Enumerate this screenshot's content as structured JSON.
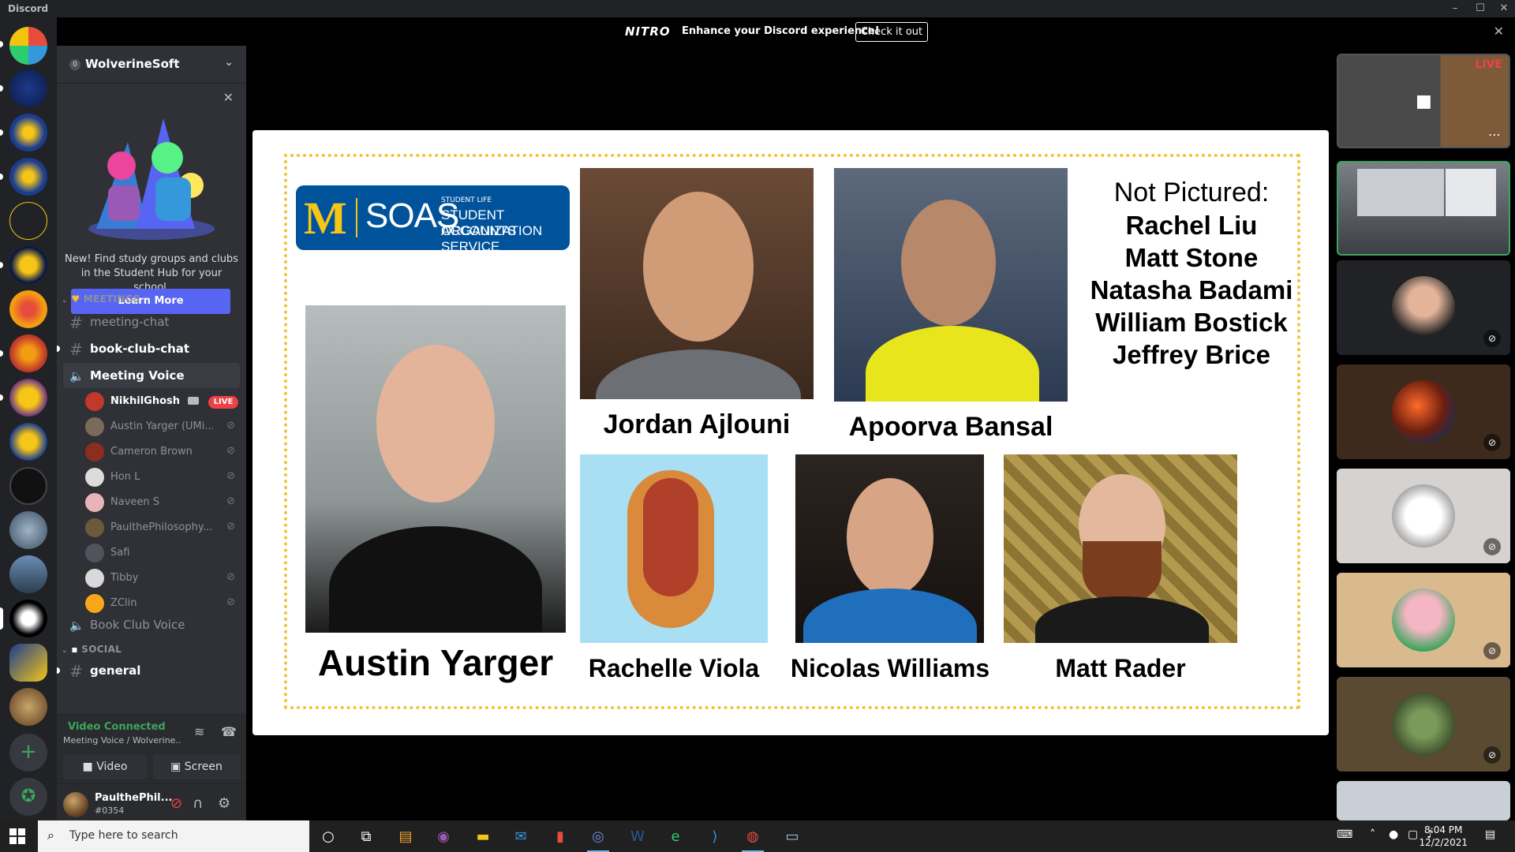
{
  "window": {
    "app_title": "Discord",
    "minimize": "–",
    "maximize": "☐",
    "close": "✕"
  },
  "nitro_banner": {
    "logo": "NITRO",
    "message": "Enhance your Discord experience!",
    "cta": "Check it out",
    "close": "✕"
  },
  "guild": {
    "name": "WolverineSoft",
    "badge": "0",
    "chevron": "⌄"
  },
  "student_hub": {
    "text": "New! Find study groups and clubs in the Student Hub for your school.",
    "button": "Learn More",
    "close": "✕"
  },
  "categories": {
    "meetings": "MEETINGS",
    "social": "SOCIAL"
  },
  "channels": {
    "meeting_chat": "meeting-chat",
    "book_club_chat": "book-club-chat",
    "meeting_voice": "Meeting Voice",
    "book_club_voice": "Book Club Voice",
    "general": "general"
  },
  "voice_users": [
    {
      "name": "NikhilGhosh",
      "live": "LIVE",
      "color": "#c0392b"
    },
    {
      "name": "Austin Yarger (UMi...",
      "color": "#7a6a5a"
    },
    {
      "name": "Cameron Brown",
      "color": "#8b2e1e"
    },
    {
      "name": "Hon L",
      "color": "#dcdcdc"
    },
    {
      "name": "Naveen S",
      "color": "#e8b4b8"
    },
    {
      "name": "PaulthePhilosophy...",
      "color": "#6b5a3a"
    },
    {
      "name": "Safi",
      "color": "#4f545c"
    },
    {
      "name": "Tibby",
      "color": "#d9d9d9"
    },
    {
      "name": "ZClin",
      "color": "#faa61a"
    }
  ],
  "voice_panel": {
    "status": "Video Connected",
    "sub": "Meeting Voice / Wolverine...",
    "video_button": "Video",
    "screen_button": "Screen"
  },
  "user": {
    "name": "PaulthePhil...",
    "tag": "#0354"
  },
  "slide": {
    "logo_m": "M",
    "logo_soas": "SOAS",
    "logo_line1": "STUDENT LIFE",
    "logo_line2": "STUDENT ORGANIZATION",
    "logo_line3": "ACCOUNTS SERVICE",
    "not_pictured_title": "Not Pictured:",
    "not_pictured": [
      "Rachel Liu",
      "Matt Stone",
      "Natasha Badami",
      "William Bostick",
      "Jeffrey Brice"
    ],
    "people": {
      "austin": "Austin Yarger",
      "jordan": "Jordan Ajlouni",
      "apoorva": "Apoorva Bansal",
      "rachelle": "Rachelle Viola",
      "nicolas": "Nicolas Williams",
      "matt": "Matt Rader"
    }
  },
  "tiles": {
    "live_badge": "LIVE"
  },
  "taskbar": {
    "search_placeholder": "Type here to search",
    "time": "8:04 PM",
    "date": "12/2/2021"
  }
}
